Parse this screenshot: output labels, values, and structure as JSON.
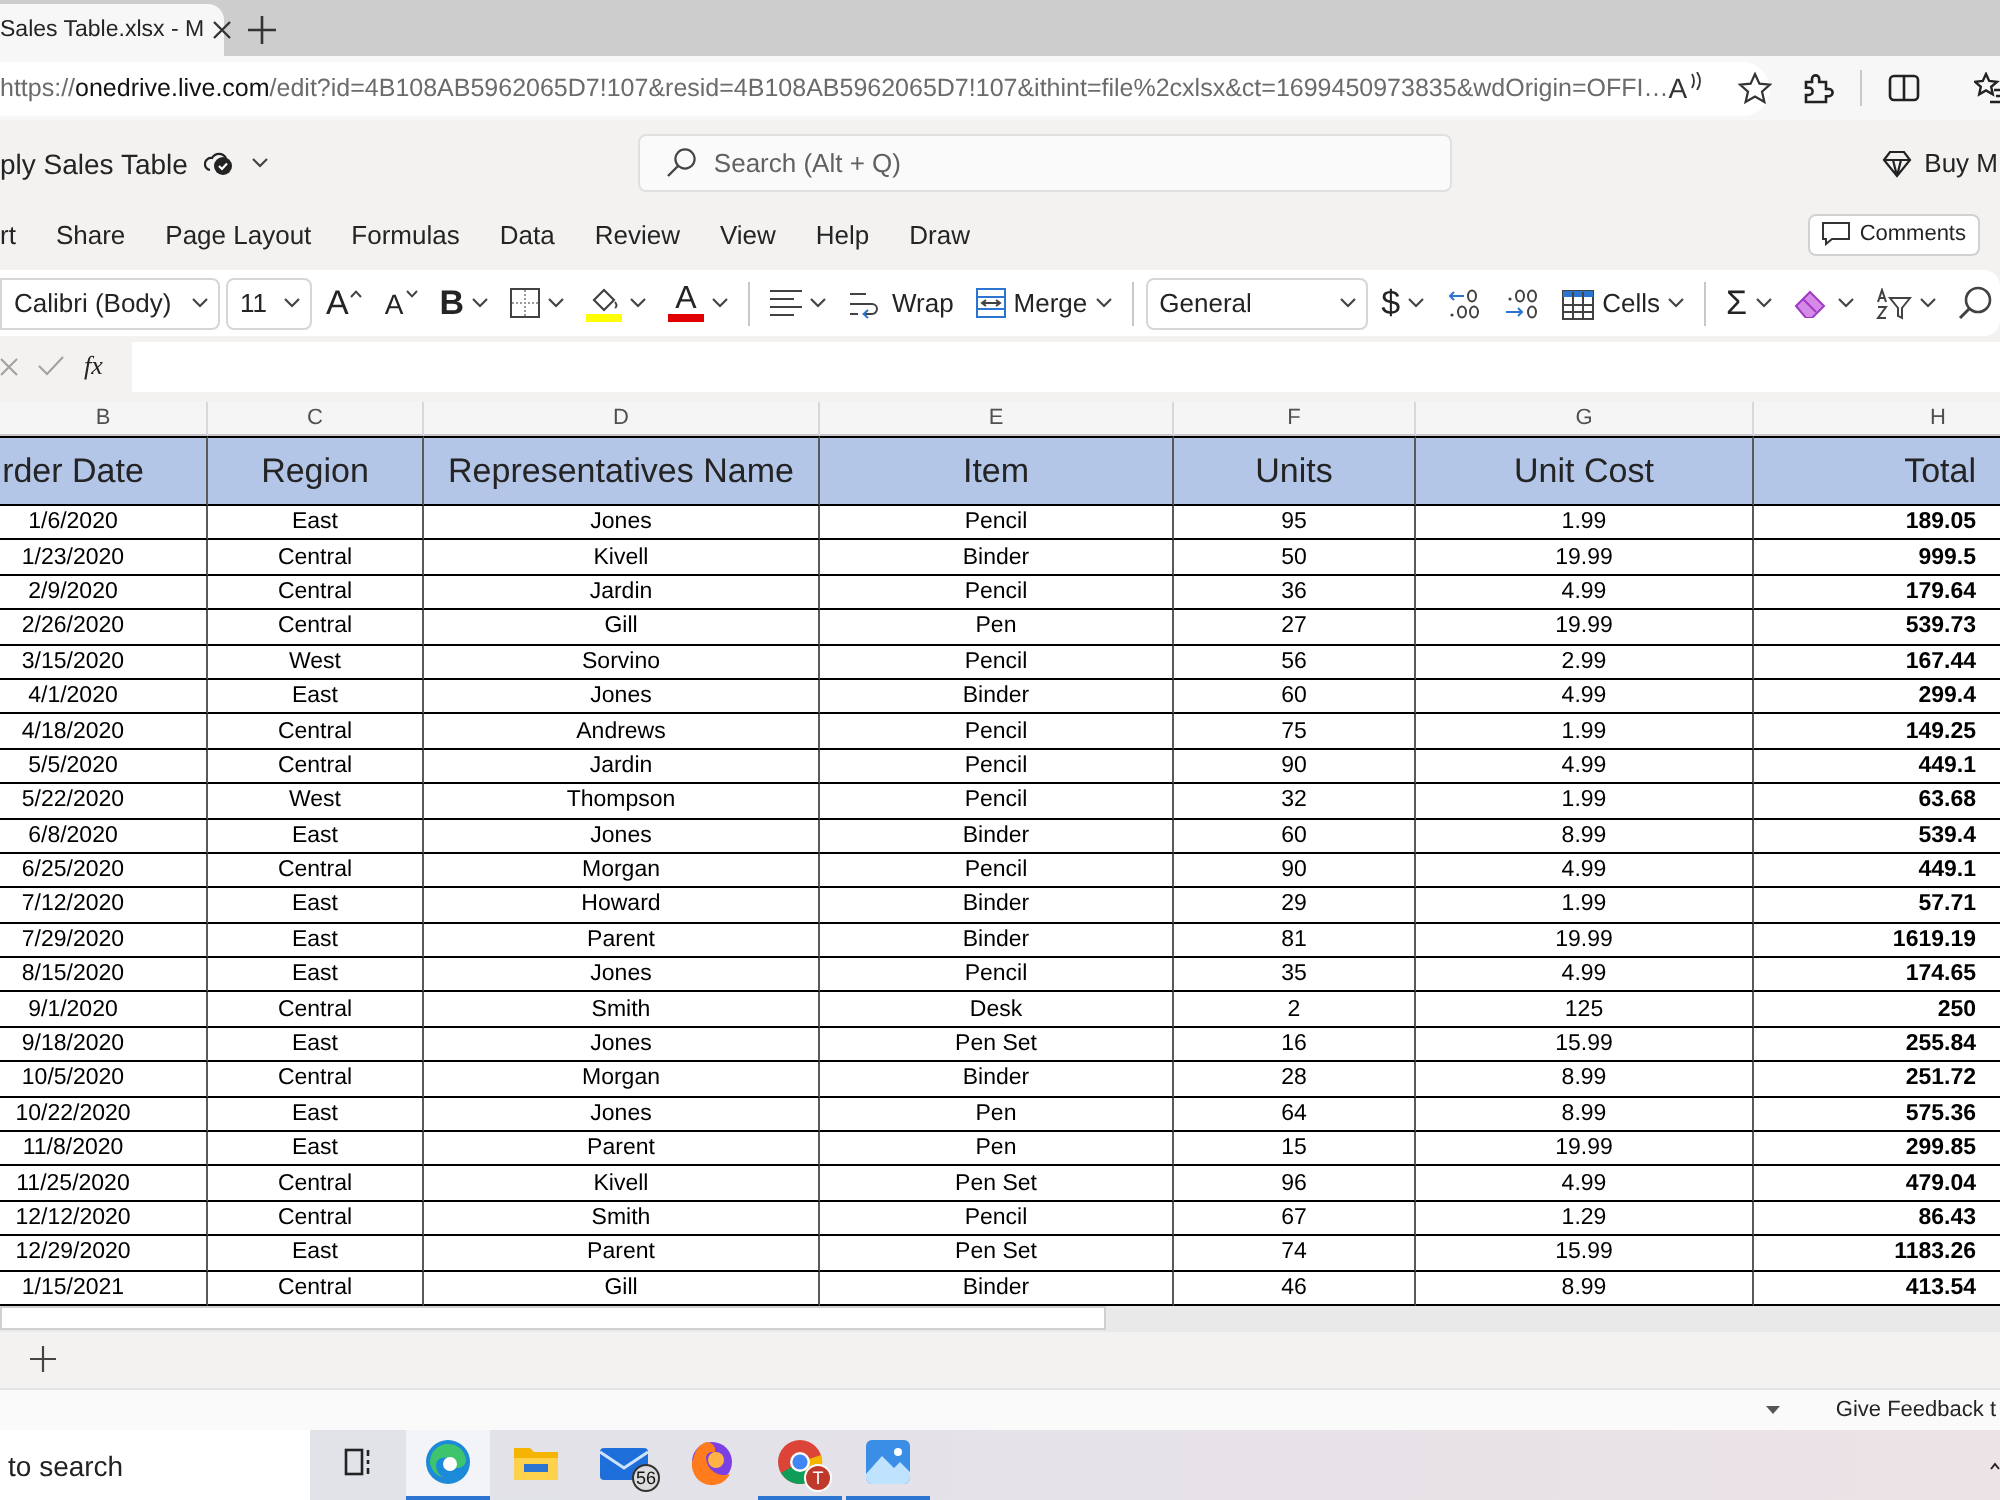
{
  "browser": {
    "tab": {
      "title": "Sales Table.xlsx - M"
    },
    "address": {
      "scheme": "https://",
      "host": "onedrive.live.com",
      "path": "/edit?id=4B108AB5962065D7!107&resid=4B108AB5962065D7!107&ithint=file%2cxlsx&ct=1699450973835&wdOrigin=OFFI…"
    },
    "read_aloud": "A"
  },
  "app_bar": {
    "file_name": "ply Sales Table",
    "search": {
      "placeholder": "Search (Alt + Q)"
    },
    "buy_button": "Buy M"
  },
  "ribbon_tabs": [
    {
      "label": "rt"
    },
    {
      "label": "Share"
    },
    {
      "label": "Page Layout"
    },
    {
      "label": "Formulas"
    },
    {
      "label": "Data"
    },
    {
      "label": "Review"
    },
    {
      "label": "View"
    },
    {
      "label": "Help"
    },
    {
      "label": "Draw"
    }
  ],
  "comments_button": "Comments",
  "toolbar": [
    [
      {
        "kind": "font",
        "value": "Calibri (Body)"
      },
      {
        "kind": "size",
        "value": "11"
      },
      {
        "kind": "grow",
        "glyph": "A"
      },
      {
        "kind": "shrink",
        "glyph": "A"
      },
      {
        "kind": "bold",
        "glyph": "B"
      },
      {
        "kind": "borders"
      },
      {
        "kind": "fill"
      },
      {
        "kind": "fontcolor",
        "glyph": "A"
      }
    ],
    [
      {
        "kind": "align"
      },
      {
        "kind": "wrap",
        "label": "Wrap"
      },
      {
        "kind": "merge",
        "label": "Merge"
      }
    ],
    [
      {
        "kind": "format",
        "value": "General"
      },
      {
        "kind": "currency",
        "glyph": "$"
      },
      {
        "kind": "moredecimals"
      },
      {
        "kind": "fewerdecimals"
      },
      {
        "kind": "cells",
        "label": "Cells"
      }
    ],
    [
      {
        "kind": "sum",
        "glyph": "Σ"
      },
      {
        "kind": "clear"
      },
      {
        "kind": "sort"
      },
      {
        "kind": "find"
      }
    ]
  ],
  "formula_bar": {
    "function_button": "fx"
  },
  "sheet": {
    "columns": [
      "B",
      "C",
      "D",
      "E",
      "F",
      "G",
      "H"
    ],
    "headers": [
      "rder Date",
      "Region",
      "Representatives Name",
      "Item",
      "Units",
      "Unit Cost",
      "Total"
    ],
    "rows": [
      [
        "1/6/2020",
        "East",
        "Jones",
        "Pencil",
        "95",
        "1.99",
        "189.05"
      ],
      [
        "1/23/2020",
        "Central",
        "Kivell",
        "Binder",
        "50",
        "19.99",
        "999.5"
      ],
      [
        "2/9/2020",
        "Central",
        "Jardin",
        "Pencil",
        "36",
        "4.99",
        "179.64"
      ],
      [
        "2/26/2020",
        "Central",
        "Gill",
        "Pen",
        "27",
        "19.99",
        "539.73"
      ],
      [
        "3/15/2020",
        "West",
        "Sorvino",
        "Pencil",
        "56",
        "2.99",
        "167.44"
      ],
      [
        "4/1/2020",
        "East",
        "Jones",
        "Binder",
        "60",
        "4.99",
        "299.4"
      ],
      [
        "4/18/2020",
        "Central",
        "Andrews",
        "Pencil",
        "75",
        "1.99",
        "149.25"
      ],
      [
        "5/5/2020",
        "Central",
        "Jardin",
        "Pencil",
        "90",
        "4.99",
        "449.1"
      ],
      [
        "5/22/2020",
        "West",
        "Thompson",
        "Pencil",
        "32",
        "1.99",
        "63.68"
      ],
      [
        "6/8/2020",
        "East",
        "Jones",
        "Binder",
        "60",
        "8.99",
        "539.4"
      ],
      [
        "6/25/2020",
        "Central",
        "Morgan",
        "Pencil",
        "90",
        "4.99",
        "449.1"
      ],
      [
        "7/12/2020",
        "East",
        "Howard",
        "Binder",
        "29",
        "1.99",
        "57.71"
      ],
      [
        "7/29/2020",
        "East",
        "Parent",
        "Binder",
        "81",
        "19.99",
        "1619.19"
      ],
      [
        "8/15/2020",
        "East",
        "Jones",
        "Pencil",
        "35",
        "4.99",
        "174.65"
      ],
      [
        "9/1/2020",
        "Central",
        "Smith",
        "Desk",
        "2",
        "125",
        "250"
      ],
      [
        "9/18/2020",
        "East",
        "Jones",
        "Pen Set",
        "16",
        "15.99",
        "255.84"
      ],
      [
        "10/5/2020",
        "Central",
        "Morgan",
        "Binder",
        "28",
        "8.99",
        "251.72"
      ],
      [
        "10/22/2020",
        "East",
        "Jones",
        "Pen",
        "64",
        "8.99",
        "575.36"
      ],
      [
        "11/8/2020",
        "East",
        "Parent",
        "Pen",
        "15",
        "19.99",
        "299.85"
      ],
      [
        "11/25/2020",
        "Central",
        "Kivell",
        "Pen Set",
        "96",
        "4.99",
        "479.04"
      ],
      [
        "12/12/2020",
        "Central",
        "Smith",
        "Pencil",
        "67",
        "1.29",
        "86.43"
      ],
      [
        "12/29/2020",
        "East",
        "Parent",
        "Pen Set",
        "74",
        "15.99",
        "1183.26"
      ],
      [
        "1/15/2021",
        "Central",
        "Gill",
        "Binder",
        "46",
        "8.99",
        "413.54"
      ]
    ]
  },
  "status_bar": {
    "feedback": "Give Feedback t"
  },
  "taskbar": {
    "search": {
      "placeholder": "to search"
    },
    "apps": [
      {
        "kind": "taskview",
        "selected": false,
        "running": false
      },
      {
        "kind": "browser",
        "selected": true,
        "running": true
      },
      {
        "kind": "folder",
        "selected": false,
        "running": false
      },
      {
        "kind": "mail",
        "badge": "56",
        "selected": false,
        "running": false
      },
      {
        "kind": "fox",
        "selected": false,
        "running": false
      },
      {
        "kind": "chrome",
        "badge": "T",
        "selected": false,
        "running": true
      },
      {
        "kind": "photos",
        "selected": false,
        "running": true
      }
    ]
  }
}
